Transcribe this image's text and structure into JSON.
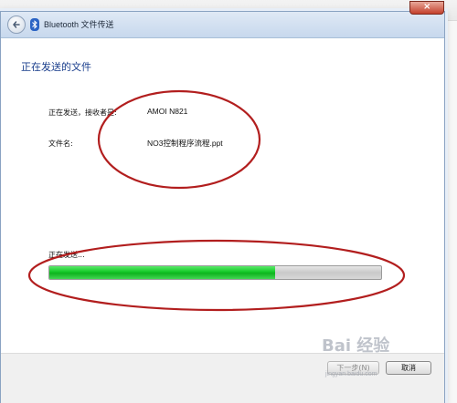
{
  "window": {
    "title": "Bluetooth 文件传送",
    "close_glyph": "×"
  },
  "page": {
    "heading": "正在发送的文件",
    "receiver_label": "正在发送，接收者是:",
    "receiver_value": "AMOI N821",
    "filename_label": "文件名:",
    "filename_value": "NO3控制程序流程.ppt"
  },
  "progress": {
    "label": "正在发送...",
    "percent": 68
  },
  "footer": {
    "next_label": "下一步(N)",
    "cancel_label": "取消"
  },
  "watermark": {
    "brand": "Bai 经验",
    "url": "jingyan.baidu.com"
  },
  "colors": {
    "heading": "#1a3e8c",
    "progress_fill": "#13c827",
    "annotation_ellipse": "#b21e1e"
  },
  "icons": [
    "back-arrow-icon",
    "bluetooth-icon",
    "close-icon"
  ]
}
